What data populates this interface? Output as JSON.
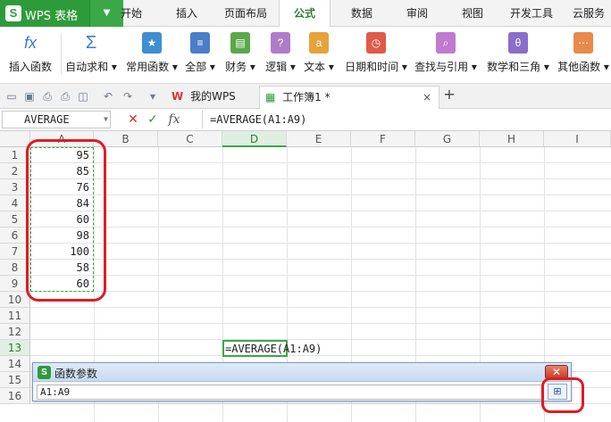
{
  "app": {
    "name": "WPS 表格",
    "logo": "S"
  },
  "menu_tabs": [
    "开始",
    "插入",
    "页面布局",
    "公式",
    "数据",
    "审阅",
    "视图",
    "开发工具",
    "云服务"
  ],
  "active_menu_tab": "公式",
  "ribbon": [
    {
      "label": "插入函数",
      "icon": "fx-icon"
    },
    {
      "label": "自动求和 ▾",
      "icon": "sigma-icon"
    },
    {
      "label": "常用函数 ▾",
      "icon": "star-book-icon"
    },
    {
      "label": "全部 ▾",
      "icon": "book-icon"
    },
    {
      "label": "财务 ▾",
      "icon": "finance-book-icon"
    },
    {
      "label": "逻辑 ▾",
      "icon": "question-book-icon"
    },
    {
      "label": "文本 ▾",
      "icon": "text-book-icon"
    },
    {
      "label": "日期和时间 ▾",
      "icon": "clock-book-icon"
    },
    {
      "label": "查找与引用 ▾",
      "icon": "search-book-icon"
    },
    {
      "label": "数学和三角 ▾",
      "icon": "theta-book-icon"
    },
    {
      "label": "其他函数 ▾",
      "icon": "more-book-icon"
    }
  ],
  "doc_tabs": [
    {
      "label": "我的WPS",
      "icon": "wps-logo-icon"
    },
    {
      "label": "工作簿1 *",
      "icon": "sheet-icon"
    }
  ],
  "formula_bar": {
    "name_box": "AVERAGE",
    "formula": "=AVERAGE(A1:A9)"
  },
  "columns": [
    "A",
    "B",
    "C",
    "D",
    "E",
    "F",
    "G",
    "H",
    "I"
  ],
  "rows": [
    "1",
    "2",
    "3",
    "4",
    "5",
    "6",
    "7",
    "8",
    "9",
    "10",
    "11",
    "12",
    "13",
    "14",
    "15",
    "16"
  ],
  "cells": {
    "A1": "95",
    "A2": "85",
    "A3": "76",
    "A4": "84",
    "A5": "60",
    "A6": "98",
    "A7": "100",
    "A8": "58",
    "A9": "60",
    "D13": "=AVERAGE(A1:A9)"
  },
  "dialog": {
    "title": "函数参数",
    "input": "A1:A9"
  },
  "colors": {
    "accent": "#2e9b3a",
    "highlight": "#e01b24"
  }
}
